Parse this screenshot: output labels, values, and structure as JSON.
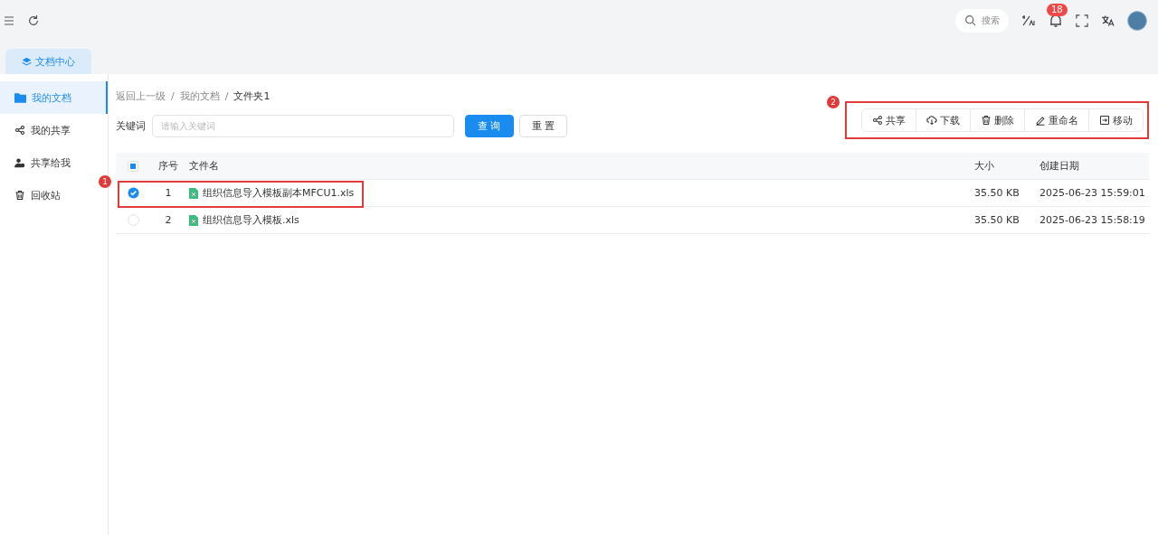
{
  "topbar": {
    "search_placeholder": "搜索",
    "notification_count": "18"
  },
  "tabs": [
    {
      "label": "文档中心",
      "selected": true
    }
  ],
  "sidebar": {
    "items": [
      {
        "label": "我的文档",
        "kind": "folder",
        "selected": true
      },
      {
        "label": "我的共享",
        "kind": "share",
        "selected": false
      },
      {
        "label": "共享给我",
        "kind": "users",
        "selected": false
      },
      {
        "label": "回收站",
        "kind": "trash",
        "selected": false
      }
    ]
  },
  "breadcrumb": [
    {
      "label": "返回上一级"
    },
    {
      "separator": "/",
      "label": "我的文档"
    },
    {
      "separator": "/",
      "label": "文件夹1"
    }
  ],
  "filter": {
    "label": "关键词",
    "placeholder": "请输入关键词",
    "buttons": [
      {
        "label": "查 询",
        "kind": "primary"
      },
      {
        "label": "重 置",
        "kind": "default"
      }
    ]
  },
  "toolbar": {
    "annotation": "2",
    "buttons": [
      {
        "label": "共享",
        "kind": "share"
      },
      {
        "label": "下载",
        "kind": "download"
      },
      {
        "label": "删除",
        "kind": "delete"
      },
      {
        "label": "重命名",
        "kind": "rename"
      },
      {
        "label": "移动",
        "kind": "move"
      }
    ]
  },
  "table": {
    "header_checkbox": {
      "partial": true
    },
    "columns": [
      "序号",
      "文件名",
      "大小",
      "创建日期"
    ],
    "rows": [
      {
        "annotation": "1",
        "checked": true,
        "index": "1",
        "name": "组织信息导入模板副本MFCU1.xls",
        "size": "35.50 KB",
        "created": "2025-06-23 15:59:01"
      },
      {
        "checked": false,
        "index": "2",
        "name": "组织信息导入模板.xls",
        "size": "35.50 KB",
        "created": "2025-06-23 15:58:19"
      }
    ]
  }
}
